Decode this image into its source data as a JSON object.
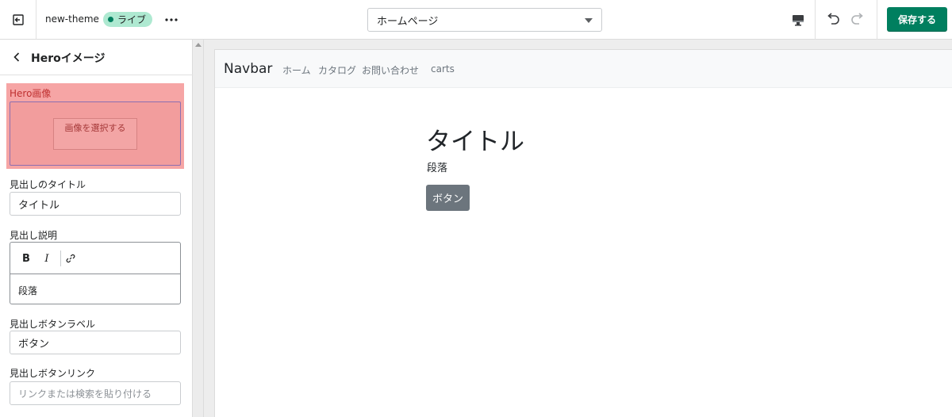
{
  "topbar": {
    "theme_name": "new-theme",
    "live_badge": "ライブ",
    "page_select": "ホームページ",
    "save_label": "保存する"
  },
  "sidebar": {
    "title": "Heroイメージ",
    "hero_label": "Hero画像",
    "select_image_label": "画像を選択する",
    "heading_title_label": "見出しのタイトル",
    "heading_title_value": "タイトル",
    "heading_desc_label": "見出し説明",
    "rte_bold": "B",
    "rte_italic": "I",
    "heading_desc_value": "段落",
    "button_label_label": "見出しボタンラベル",
    "button_label_value": "ボタン",
    "button_link_label": "見出しボタンリンク",
    "button_link_placeholder": "リンクまたは検索を貼り付ける"
  },
  "preview": {
    "brand": "Navbar",
    "nav_links": [
      "ホーム",
      "カタログ",
      "お問い合わせ",
      "carts"
    ],
    "title": "タイトル",
    "paragraph": "段落",
    "button": "ボタン"
  },
  "icons": {
    "exit": "exit-icon",
    "more": "more-horizontal-icon",
    "device": "desktop-icon",
    "undo": "undo-icon",
    "redo": "redo-icon",
    "back": "chevron-left-icon",
    "link": "link-icon"
  },
  "colors": {
    "primary": "#007f5f",
    "live_badge_bg": "#aee9d1",
    "hero_highlight": "#f6a5a5",
    "preview_button": "#6c757d"
  }
}
